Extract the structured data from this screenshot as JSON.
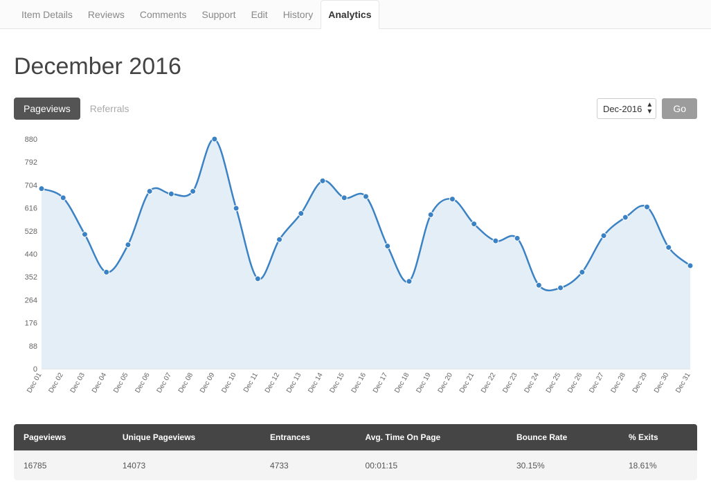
{
  "tabs": {
    "item_details": "Item Details",
    "reviews": "Reviews",
    "comments": "Comments",
    "support": "Support",
    "edit": "Edit",
    "history": "History",
    "analytics": "Analytics"
  },
  "page_title": "December 2016",
  "view_pills": {
    "pageviews": "Pageviews",
    "referrals": "Referrals"
  },
  "controls": {
    "period_selected": "Dec-2016",
    "go_label": "Go"
  },
  "stats": {
    "headers": {
      "pageviews": "Pageviews",
      "unique_pageviews": "Unique Pageviews",
      "entrances": "Entrances",
      "avg_time": "Avg. Time On Page",
      "bounce_rate": "Bounce Rate",
      "exits": "% Exits"
    },
    "values": {
      "pageviews": "16785",
      "unique_pageviews": "14073",
      "entrances": "4733",
      "avg_time": "00:01:15",
      "bounce_rate": "30.15%",
      "exits": "18.61%"
    }
  },
  "chart_data": {
    "type": "area",
    "title": "",
    "xlabel": "",
    "ylabel": "",
    "ylim": [
      0,
      880
    ],
    "y_ticks": [
      0,
      88,
      176,
      264,
      352,
      440,
      528,
      616,
      704,
      792,
      880
    ],
    "categories": [
      "Dec 01",
      "Dec 02",
      "Dec 03",
      "Dec 04",
      "Dec 05",
      "Dec 06",
      "Dec 07",
      "Dec 08",
      "Dec 09",
      "Dec 10",
      "Dec 11",
      "Dec 12",
      "Dec 13",
      "Dec 14",
      "Dec 15",
      "Dec 16",
      "Dec 17",
      "Dec 18",
      "Dec 19",
      "Dec 20",
      "Dec 21",
      "Dec 22",
      "Dec 23",
      "Dec 24",
      "Dec 25",
      "Dec 26",
      "Dec 27",
      "Dec 28",
      "Dec 29",
      "Dec 30",
      "Dec 31"
    ],
    "values": [
      690,
      655,
      515,
      370,
      475,
      680,
      670,
      680,
      880,
      615,
      345,
      495,
      595,
      720,
      655,
      660,
      470,
      335,
      590,
      650,
      555,
      490,
      500,
      320,
      310,
      370,
      510,
      580,
      620,
      465,
      395
    ],
    "colors": {
      "line": "#3b82c4",
      "fill": "#e3eef7",
      "point": "#3b82c4"
    }
  }
}
